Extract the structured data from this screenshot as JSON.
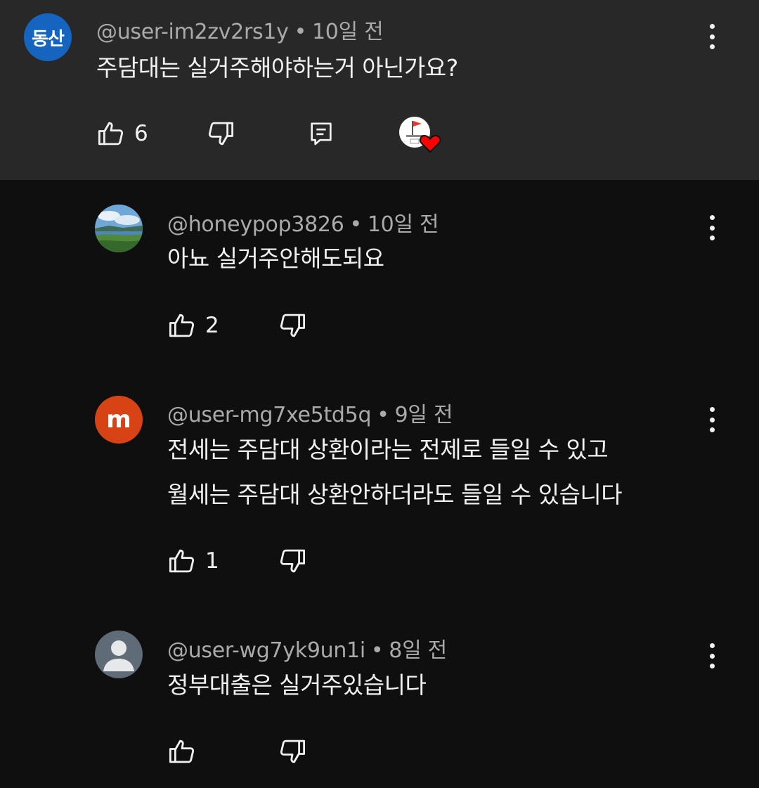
{
  "colors": {
    "background": "#0f0f0f",
    "highlight_background": "#282828",
    "text_primary": "#f1f1f1",
    "text_secondary": "#aaaaaa",
    "heart_red": "#ff0000"
  },
  "main_comment": {
    "avatar_text": "동산",
    "username": "@user-im2zv2rs1y",
    "separator": "•",
    "time": "10일 전",
    "text": "주담대는 실거주해야하는거 아닌가요?",
    "likes": "6",
    "icons": [
      "thumbs-up-icon",
      "thumbs-down-icon",
      "reply-icon",
      "creator-heart-icon",
      "more-vert-icon"
    ]
  },
  "replies": [
    {
      "username": "@honeypop3826",
      "separator": "•",
      "time": "10일 전",
      "lines": [
        "아뇨 실거주안해도되요"
      ],
      "likes": "2"
    },
    {
      "avatar_text": "m",
      "username": "@user-mg7xe5td5q",
      "separator": "•",
      "time": "9일 전",
      "lines": [
        "전세는 주담대 상환이라는 전제로 들일 수 있고",
        "월세는 주담대 상환안하더라도 들일 수 있습니다"
      ],
      "likes": "1"
    },
    {
      "username": "@user-wg7yk9un1i",
      "separator": "•",
      "time": "8일 전",
      "lines": [
        "정부대출은 실거주있습니다"
      ],
      "likes": ""
    }
  ]
}
